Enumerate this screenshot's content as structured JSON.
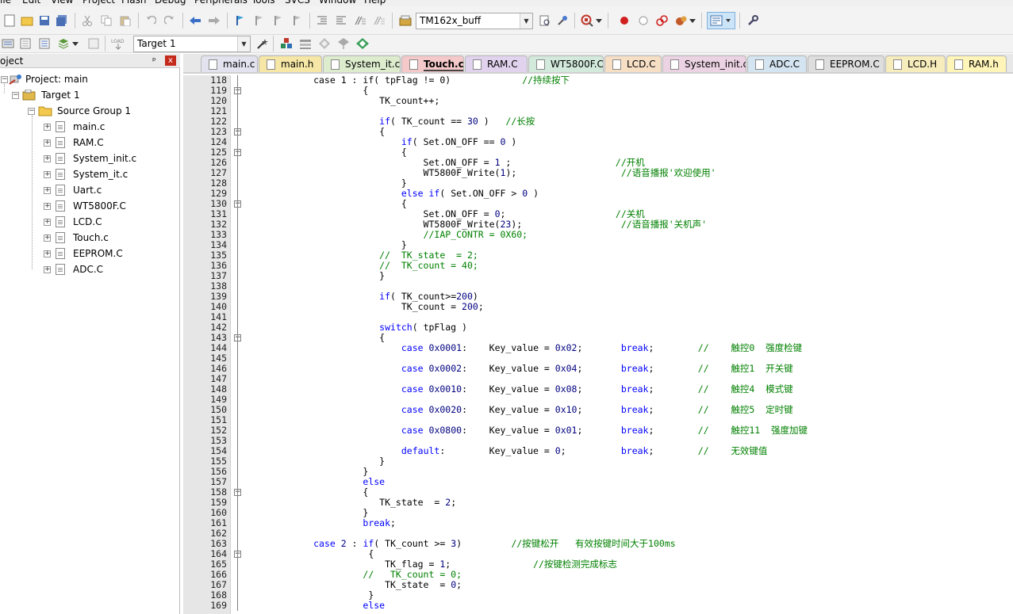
{
  "menu": [
    "ile",
    "Edit",
    "View",
    "Project",
    "Flash",
    "Debug",
    "Peripherals",
    "Tools",
    "SVCS",
    "Window",
    "Help"
  ],
  "toolbar": {
    "target_combo": "TM162x_buff",
    "target_select": "Target 1",
    "load_label": "LOAD"
  },
  "project_panel": {
    "title": "oject",
    "pin": "ᵖ",
    "close": "x",
    "root": "Project: main",
    "target": "Target 1",
    "group": "Source Group 1",
    "files": [
      "main.c",
      "RAM.C",
      "System_init.c",
      "System_it.c",
      "Uart.c",
      "WT5800F.C",
      "LCD.C",
      "Touch.c",
      "EEPROM.C",
      "ADC.C"
    ]
  },
  "tabs": [
    {
      "label": "main.c",
      "color": "#e3e3f0"
    },
    {
      "label": "main.h",
      "color": "#f6e7a6"
    },
    {
      "label": "System_it.c",
      "color": "#dceccd"
    },
    {
      "label": "Touch.c",
      "color": "#f5c9c9",
      "active": true
    },
    {
      "label": "RAM.C",
      "color": "#e1d3ee"
    },
    {
      "label": "WT5800F.C",
      "color": "#d2e9dc"
    },
    {
      "label": "LCD.C",
      "color": "#f7dfc6"
    },
    {
      "label": "System_init.c",
      "color": "#ecd3e3"
    },
    {
      "label": "ADC.C",
      "color": "#d4e4f0"
    },
    {
      "label": "EEPROM.C",
      "color": "#dedede"
    },
    {
      "label": "LCD.H",
      "color": "#f6ecbc"
    },
    {
      "label": "RAM.h",
      "color": "#fff5b8"
    }
  ],
  "editor": {
    "line_numbers": [
      "118",
      "119",
      "120",
      "121",
      "122",
      "123",
      "124",
      "125",
      "126",
      "127",
      "128",
      "129",
      "130",
      "131",
      "132",
      "133",
      "134",
      "135",
      "136",
      "137",
      "138",
      "139",
      "140",
      "141",
      "142",
      "143",
      "144",
      "145",
      "146",
      "147",
      "148",
      "149",
      "150",
      "151",
      "152",
      "153",
      "154",
      "155",
      "156",
      "157",
      "158",
      "159",
      "160",
      "161",
      "162",
      "163",
      "164",
      "165",
      "166",
      "167",
      "168",
      "169"
    ],
    "fold_marks": {
      "119": "−",
      "123": "−",
      "125": "−",
      "130": "−",
      "143": "−",
      "158": "−",
      "164": "−"
    },
    "lines": [
      [
        [
          "n",
          "            case 1 : if( tpFlag != 0)             "
        ],
        [
          "c",
          "//持续按下"
        ]
      ],
      [
        [
          "n",
          "                     {"
        ]
      ],
      [
        [
          "n",
          "                        TK_count++;"
        ]
      ],
      [
        [
          "n",
          ""
        ]
      ],
      [
        [
          "n",
          "                        "
        ],
        [
          "k",
          "if"
        ],
        [
          "n",
          "( TK_count == "
        ],
        [
          "m",
          "30"
        ],
        [
          "n",
          " )   "
        ],
        [
          "c",
          "//长按"
        ]
      ],
      [
        [
          "n",
          "                        {"
        ]
      ],
      [
        [
          "n",
          "                            "
        ],
        [
          "k",
          "if"
        ],
        [
          "n",
          "( Set.ON_OFF == "
        ],
        [
          "m",
          "0"
        ],
        [
          "n",
          " )"
        ]
      ],
      [
        [
          "n",
          "                            {"
        ]
      ],
      [
        [
          "n",
          "                                Set.ON_OFF = "
        ],
        [
          "m",
          "1"
        ],
        [
          "n",
          " ;                   "
        ],
        [
          "c",
          "//开机"
        ]
      ],
      [
        [
          "n",
          "                                WT5800F_Write("
        ],
        [
          "m",
          "1"
        ],
        [
          "n",
          ");                   "
        ],
        [
          "c",
          "//语音播报'欢迎使用'"
        ]
      ],
      [
        [
          "n",
          "                            }"
        ]
      ],
      [
        [
          "n",
          "                            "
        ],
        [
          "k",
          "else if"
        ],
        [
          "n",
          "( Set.ON_OFF > "
        ],
        [
          "m",
          "0"
        ],
        [
          "n",
          " )"
        ]
      ],
      [
        [
          "n",
          "                            {"
        ]
      ],
      [
        [
          "n",
          "                                Set.ON_OFF = "
        ],
        [
          "m",
          "0"
        ],
        [
          "n",
          ";                    "
        ],
        [
          "c",
          "//关机"
        ]
      ],
      [
        [
          "n",
          "                                WT5800F_Write("
        ],
        [
          "m",
          "23"
        ],
        [
          "n",
          ");                  "
        ],
        [
          "c",
          "//语音播报'关机声'"
        ]
      ],
      [
        [
          "n",
          "                                "
        ],
        [
          "c",
          "//IAP_CONTR = 0X60;"
        ]
      ],
      [
        [
          "n",
          "                            }"
        ]
      ],
      [
        [
          "c",
          "                        //  TK_state  = 2;"
        ]
      ],
      [
        [
          "c",
          "                        //  TK_count = 40;"
        ]
      ],
      [
        [
          "n",
          "                        }"
        ]
      ],
      [
        [
          "n",
          ""
        ]
      ],
      [
        [
          "n",
          "                        "
        ],
        [
          "k",
          "if"
        ],
        [
          "n",
          "( TK_count>="
        ],
        [
          "m",
          "200"
        ],
        [
          "n",
          ")"
        ]
      ],
      [
        [
          "n",
          "                            TK_count = "
        ],
        [
          "m",
          "200"
        ],
        [
          "n",
          ";"
        ]
      ],
      [
        [
          "n",
          ""
        ]
      ],
      [
        [
          "n",
          "                        "
        ],
        [
          "k",
          "switch"
        ],
        [
          "n",
          "( tpFlag )"
        ]
      ],
      [
        [
          "n",
          "                        {"
        ]
      ],
      [
        [
          "n",
          "                            "
        ],
        [
          "k",
          "case"
        ],
        [
          "n",
          " "
        ],
        [
          "m",
          "0x0001"
        ],
        [
          "n",
          ":    Key_value = "
        ],
        [
          "m",
          "0x02"
        ],
        [
          "n",
          ";       "
        ],
        [
          "k",
          "break"
        ],
        [
          "n",
          ";        "
        ],
        [
          "c",
          "//    触控0  强度检键"
        ]
      ],
      [
        [
          "n",
          ""
        ]
      ],
      [
        [
          "n",
          "                            "
        ],
        [
          "k",
          "case"
        ],
        [
          "n",
          " "
        ],
        [
          "m",
          "0x0002"
        ],
        [
          "n",
          ":    Key_value = "
        ],
        [
          "m",
          "0x04"
        ],
        [
          "n",
          ";       "
        ],
        [
          "k",
          "break"
        ],
        [
          "n",
          ";        "
        ],
        [
          "c",
          "//    触控1  开关键"
        ]
      ],
      [
        [
          "n",
          ""
        ]
      ],
      [
        [
          "n",
          "                            "
        ],
        [
          "k",
          "case"
        ],
        [
          "n",
          " "
        ],
        [
          "m",
          "0x0010"
        ],
        [
          "n",
          ":    Key_value = "
        ],
        [
          "m",
          "0x08"
        ],
        [
          "n",
          ";       "
        ],
        [
          "k",
          "break"
        ],
        [
          "n",
          ";        "
        ],
        [
          "c",
          "//    触控4  模式键"
        ]
      ],
      [
        [
          "n",
          ""
        ]
      ],
      [
        [
          "n",
          "                            "
        ],
        [
          "k",
          "case"
        ],
        [
          "n",
          " "
        ],
        [
          "m",
          "0x0020"
        ],
        [
          "n",
          ":    Key_value = "
        ],
        [
          "m",
          "0x10"
        ],
        [
          "n",
          ";       "
        ],
        [
          "k",
          "break"
        ],
        [
          "n",
          ";        "
        ],
        [
          "c",
          "//    触控5  定时键"
        ]
      ],
      [
        [
          "n",
          ""
        ]
      ],
      [
        [
          "n",
          "                            "
        ],
        [
          "k",
          "case"
        ],
        [
          "n",
          " "
        ],
        [
          "m",
          "0x0800"
        ],
        [
          "n",
          ":    Key_value = "
        ],
        [
          "m",
          "0x01"
        ],
        [
          "n",
          ";       "
        ],
        [
          "k",
          "break"
        ],
        [
          "n",
          ";        "
        ],
        [
          "c",
          "//    触控11  强度加键"
        ]
      ],
      [
        [
          "n",
          ""
        ]
      ],
      [
        [
          "n",
          "                            "
        ],
        [
          "k",
          "default"
        ],
        [
          "n",
          ":        Key_value = "
        ],
        [
          "m",
          "0"
        ],
        [
          "n",
          ";          "
        ],
        [
          "k",
          "break"
        ],
        [
          "n",
          ";        "
        ],
        [
          "c",
          "//    无效键值"
        ]
      ],
      [
        [
          "n",
          "                        }"
        ]
      ],
      [
        [
          "n",
          "                     }"
        ]
      ],
      [
        [
          "n",
          "                     "
        ],
        [
          "k",
          "else"
        ]
      ],
      [
        [
          "n",
          "                     {"
        ]
      ],
      [
        [
          "n",
          "                        TK_state  = "
        ],
        [
          "m",
          "2"
        ],
        [
          "n",
          ";"
        ]
      ],
      [
        [
          "n",
          "                     }"
        ]
      ],
      [
        [
          "n",
          "                     "
        ],
        [
          "k",
          "break"
        ],
        [
          "n",
          ";"
        ]
      ],
      [
        [
          "n",
          ""
        ]
      ],
      [
        [
          "n",
          "            "
        ],
        [
          "k",
          "case"
        ],
        [
          "n",
          " "
        ],
        [
          "m",
          "2"
        ],
        [
          "n",
          " : "
        ],
        [
          "k",
          "if"
        ],
        [
          "n",
          "( TK_count >= "
        ],
        [
          "m",
          "3"
        ],
        [
          "n",
          ")         "
        ],
        [
          "c",
          "//按键松开   有效按键时间大于100ms"
        ]
      ],
      [
        [
          "n",
          "                      {"
        ]
      ],
      [
        [
          "n",
          "                         TK_flag = "
        ],
        [
          "m",
          "1"
        ],
        [
          "n",
          ";               "
        ],
        [
          "c",
          "//按键检测完成标志"
        ]
      ],
      [
        [
          "c",
          "                     //   TK_count = 0;"
        ]
      ],
      [
        [
          "n",
          "                         TK_state  = "
        ],
        [
          "m",
          "0"
        ],
        [
          "n",
          ";"
        ]
      ],
      [
        [
          "n",
          "                      }"
        ]
      ],
      [
        [
          "n",
          "                     "
        ],
        [
          "k",
          "else"
        ]
      ]
    ]
  }
}
